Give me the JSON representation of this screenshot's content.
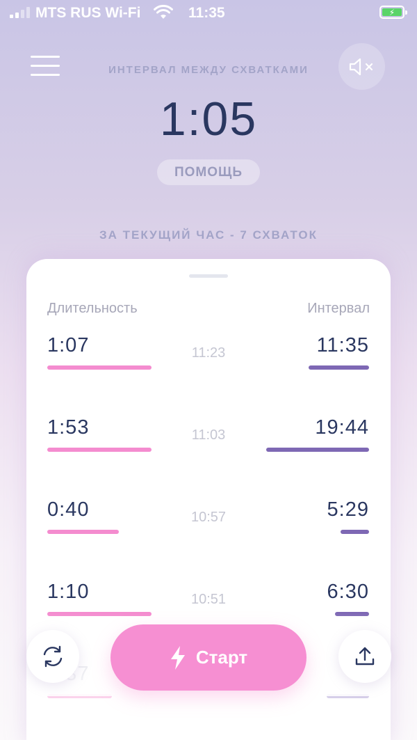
{
  "status_bar": {
    "carrier": "MTS RUS Wi-Fi",
    "time": "11:35"
  },
  "header": {
    "label": "ИНТЕРВАЛ МЕЖДУ СХВАТКАМИ",
    "timer": "1:05",
    "help_label": "ПОМОЩЬ",
    "hour_summary": "ЗА ТЕКУЩИЙ ЧАС - 7 СХВАТОК"
  },
  "table": {
    "col_duration": "Длительность",
    "col_interval": "Интервал",
    "rows": [
      {
        "duration": "1:07",
        "start_time": "11:23",
        "interval": "11:35",
        "duration_level": 0.29,
        "interval_level": 0.59
      },
      {
        "duration": "1:53",
        "start_time": "11:03",
        "interval": "19:44",
        "duration_level": 0.29,
        "interval_level": 1.0
      },
      {
        "duration": "0:40",
        "start_time": "10:57",
        "interval": "5:29",
        "duration_level": 0.2,
        "interval_level": 0.28
      },
      {
        "duration": "1:10",
        "start_time": "10:51",
        "interval": "6:30",
        "duration_level": 0.29,
        "interval_level": 0.33
      },
      {
        "duration": "0:37",
        "start_time": "",
        "interval": "8:",
        "duration_level": 0.18,
        "interval_level": 0.41
      }
    ]
  },
  "actions": {
    "start_label": "Старт"
  },
  "colors": {
    "duration_bar": "#f48ccf",
    "interval_bar": "#7e68b4",
    "start_button": "#f68fd2"
  }
}
